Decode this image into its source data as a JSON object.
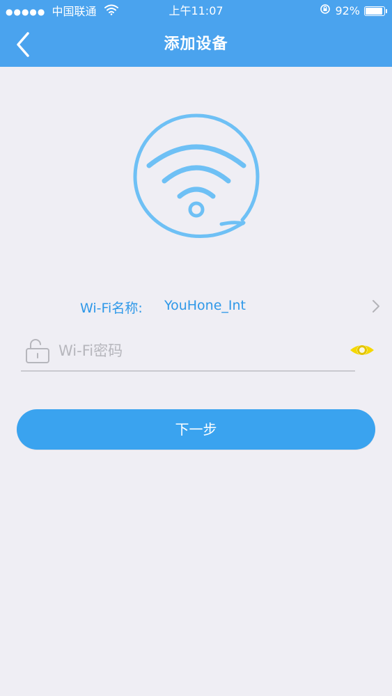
{
  "status_bar": {
    "signal_dots": "●●●●●",
    "carrier": "中国联通",
    "time": "上午11:07",
    "battery_percent": "92%",
    "battery_level": 0.92
  },
  "nav": {
    "title": "添加设备",
    "back_icon": "chevron-left-icon"
  },
  "wifi": {
    "name_label": "Wi-Fi名称:",
    "name_value": "YouHone_Int",
    "password_placeholder": "Wi-Fi密码",
    "password_value": ""
  },
  "actions": {
    "next_label": "下一步"
  },
  "colors": {
    "header_bg": "#4aa3ee",
    "accent_text": "#2e98e8",
    "button_bg": "#3aa3ef",
    "eye_icon": "#f5d800",
    "page_bg": "#efeef4"
  },
  "icons": [
    "wifi-hero-icon",
    "lock-icon",
    "eye-icon",
    "chevron-right-icon",
    "wifi-status-icon",
    "lock-rotation-icon",
    "battery-icon"
  ]
}
